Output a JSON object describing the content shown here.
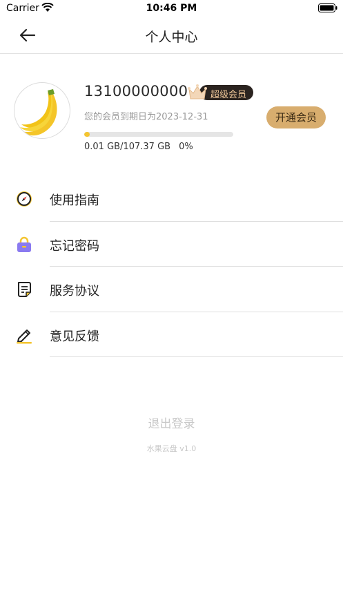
{
  "status_bar": {
    "carrier": "Carrier",
    "time": "10:46 PM"
  },
  "nav": {
    "title": "个人中心",
    "back_icon": "arrow-left-icon"
  },
  "profile": {
    "phone": "13100000000",
    "vip_label": "超级会员",
    "expiry": "您的会员到期日为2023-12-31",
    "open_vip_label": "开通会员",
    "storage_text": "0.01 GB/107.37 GB",
    "storage_percent_text": "0%",
    "storage_fraction": 0.0001,
    "avatar_icon": "banana-icon"
  },
  "menu": {
    "items": [
      {
        "label": "使用指南",
        "icon": "compass-icon"
      },
      {
        "label": "忘记密码",
        "icon": "lock-icon"
      },
      {
        "label": "服务协议",
        "icon": "document-icon"
      },
      {
        "label": "意见反馈",
        "icon": "pencil-icon"
      }
    ]
  },
  "footer": {
    "logout_label": "退出登录",
    "version": "水果云盘 v1.0"
  },
  "colors": {
    "accent_yellow": "#f4c531",
    "vip_gold": "#d8ad6e",
    "vip_dark": "#2b2420"
  }
}
